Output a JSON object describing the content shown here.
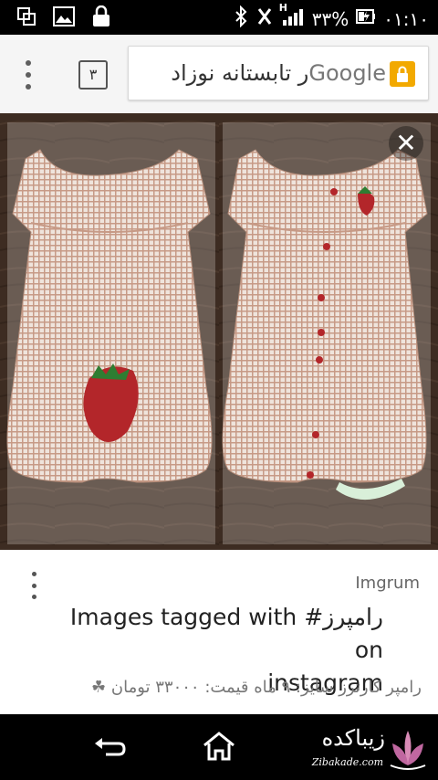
{
  "status_bar": {
    "signal_label": "H",
    "battery_percent": "۳۳%",
    "time": "۰۱:۱۰",
    "icons": [
      "screenshot-icon",
      "gallery-icon",
      "lock-icon",
      "bluetooth-icon",
      "no-sim-icon",
      "signal-icon",
      "battery-charging-icon"
    ]
  },
  "toolbar": {
    "tab_count": "۳",
    "url_host": "Google",
    "url_query": "ر تابستانه نوزاد",
    "secure_color": "#f2a900"
  },
  "viewer": {
    "close_symbol": "✕"
  },
  "result": {
    "site": "Imgrum",
    "title_line1": "Images tagged with #رامپرز on",
    "title_line2": "instagram",
    "description": "رامپر کارترز سایز: ۹ ماه قیمت: ۳۳۰۰۰ تومان"
  },
  "navbar": {
    "icons": [
      "back-icon",
      "home-icon"
    ],
    "watermark_fa": "زیباکده",
    "watermark_en": "Zibakade.com"
  }
}
